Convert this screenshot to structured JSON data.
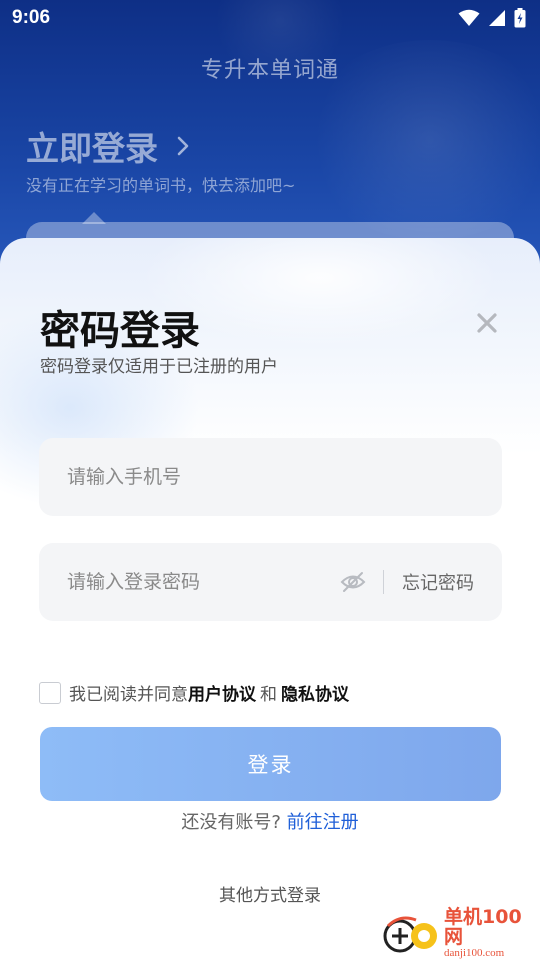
{
  "status_bar": {
    "time": "9:06",
    "icons": [
      "wifi-icon",
      "cellular-signal-icon",
      "battery-charging-icon"
    ]
  },
  "header": {
    "app_title": "专升本单词通",
    "login_link_label": "立即登录",
    "login_subtitle": "没有正在学习的单词书，快去添加吧~"
  },
  "sheet": {
    "title": "密码登录",
    "subtitle": "密码登录仅适用于已注册的用户",
    "close_icon": "close-icon",
    "phone_placeholder": "请输入手机号",
    "password_placeholder": "请输入登录密码",
    "password_visibility_icon": "eye-off-icon",
    "forgot_password_label": "忘记密码",
    "agreement": {
      "prefix": "我已阅读并同意",
      "user_agreement": "用户协议",
      "and": "和",
      "privacy_policy": "隐私协议",
      "checked": false
    },
    "login_button_label": "登录",
    "register_prompt": "还没有账号?",
    "register_link": "前往注册",
    "other_login_label": "其他方式登录"
  },
  "watermark": {
    "cn": "单机100网",
    "en": "danji100.com"
  },
  "colors": {
    "header_bg": "#1a46a6",
    "login_button": "#8ebcf7",
    "link_blue": "#1f5fd8",
    "watermark": "#e8533a"
  }
}
